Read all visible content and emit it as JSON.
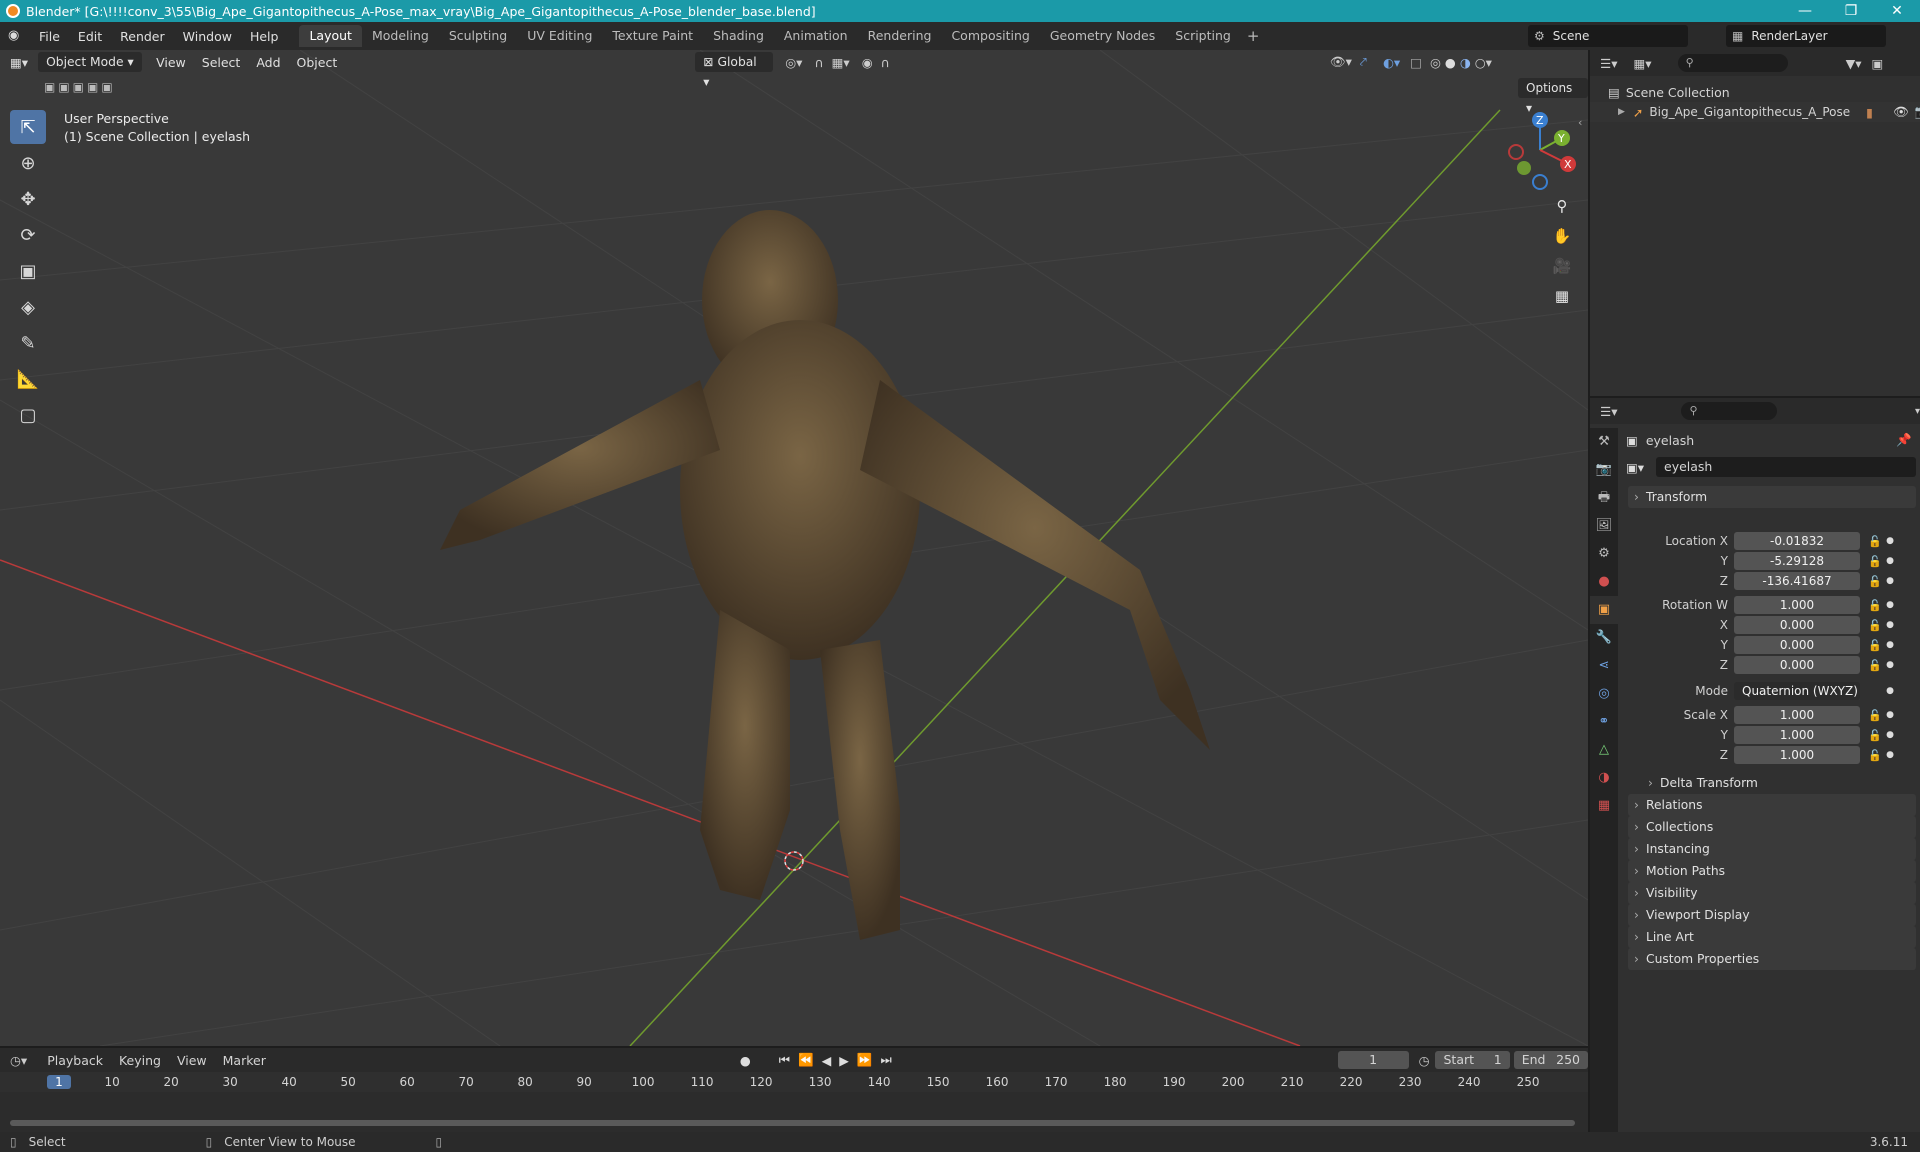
{
  "title": "Blender* [G:\\!!!!conv_3\\55\\Big_Ape_Gigantopithecus_A-Pose_max_vray\\Big_Ape_Gigantopithecus_A-Pose_blender_base.blend]",
  "menu": [
    "File",
    "Edit",
    "Render",
    "Window",
    "Help"
  ],
  "workspaces": [
    "Layout",
    "Modeling",
    "Sculpting",
    "UV Editing",
    "Texture Paint",
    "Shading",
    "Animation",
    "Rendering",
    "Compositing",
    "Geometry Nodes",
    "Scripting"
  ],
  "active_workspace": "Layout",
  "scene_name": "Scene",
  "render_layer": "RenderLayer",
  "viewport": {
    "mode": "Object Mode",
    "menus": [
      "View",
      "Select",
      "Add",
      "Object"
    ],
    "orientation": "Global",
    "options_label": "Options",
    "perspective": "User Perspective",
    "collection_info": "(1) Scene Collection | eyelash",
    "gizmo_axes": {
      "x": "X",
      "y": "Y",
      "z": "Z"
    }
  },
  "outliner": {
    "root": "Scene Collection",
    "item": "Big_Ape_Gigantopithecus_A_Pose"
  },
  "properties": {
    "object_name": "eyelash",
    "data_name": "eyelash",
    "transform_label": "Transform",
    "location": {
      "label": "Location X",
      "x": "-0.01832",
      "y": "-5.29128",
      "z": "-136.41687"
    },
    "rotation": {
      "label": "Rotation W",
      "w": "1.000",
      "x": "0.000",
      "y": "0.000",
      "z": "0.000"
    },
    "mode_label": "Mode",
    "mode_value": "Quaternion (WXYZ)",
    "scale": {
      "label": "Scale X",
      "x": "1.000",
      "y": "1.000",
      "z": "1.000"
    },
    "axis_labels": {
      "x": "X",
      "y": "Y",
      "z": "Z"
    },
    "delta": "Delta Transform",
    "panels": [
      "Relations",
      "Collections",
      "Instancing",
      "Motion Paths",
      "Visibility",
      "Viewport Display",
      "Line Art",
      "Custom Properties"
    ]
  },
  "timeline": {
    "menus": [
      "Playback",
      "Keying",
      "View",
      "Marker"
    ],
    "current_frame": "1",
    "start_label": "Start",
    "start": "1",
    "end_label": "End",
    "end": "250",
    "ticks": [
      "1",
      "10",
      "20",
      "30",
      "40",
      "50",
      "60",
      "70",
      "80",
      "90",
      "100",
      "110",
      "120",
      "130",
      "140",
      "150",
      "160",
      "170",
      "180",
      "190",
      "200",
      "210",
      "220",
      "230",
      "240",
      "250"
    ]
  },
  "status": {
    "select": "Select",
    "center": "Center View to Mouse",
    "version": "3.6.11"
  }
}
